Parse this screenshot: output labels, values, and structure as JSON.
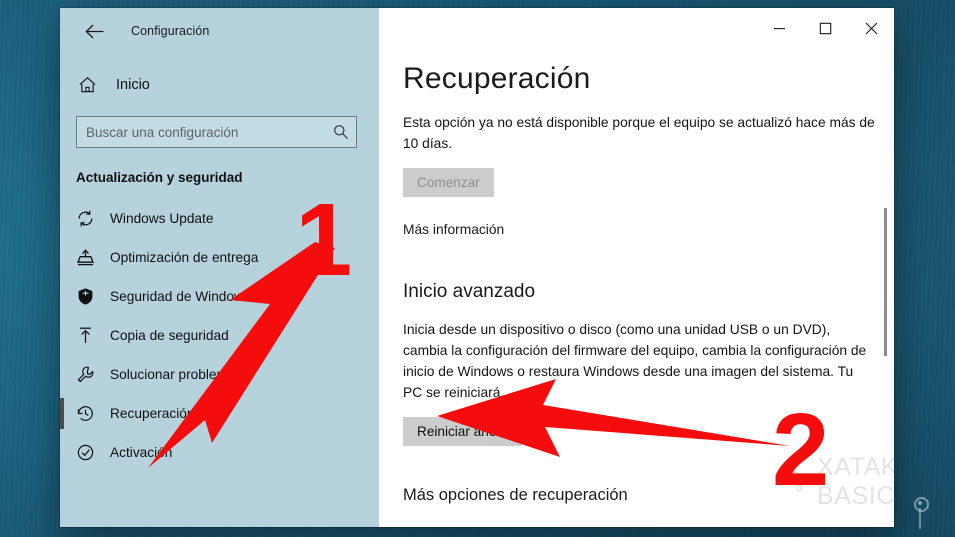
{
  "window": {
    "app_title": "Configuración",
    "back_icon": "back-arrow-icon",
    "controls": {
      "minimize": "–",
      "maximize": "□",
      "close": "✕"
    }
  },
  "sidebar": {
    "home": {
      "label": "Inicio",
      "icon": "home-icon"
    },
    "search": {
      "placeholder": "Buscar una configuración",
      "value": "",
      "icon": "search-icon"
    },
    "group_title": "Actualización y seguridad",
    "items": [
      {
        "label": "Windows Update",
        "icon": "sync-icon",
        "selected": false
      },
      {
        "label": "Optimización de entrega",
        "icon": "delivery-optimization-icon",
        "selected": false
      },
      {
        "label": "Seguridad de Windows",
        "icon": "shield-icon",
        "selected": false
      },
      {
        "label": "Copia de seguridad",
        "icon": "backup-upload-icon",
        "selected": false
      },
      {
        "label": "Solucionar problemas",
        "icon": "wrench-icon",
        "selected": false
      },
      {
        "label": "Recuperación",
        "icon": "history-clock-icon",
        "selected": true
      },
      {
        "label": "Activación",
        "icon": "check-circle-icon",
        "selected": false
      }
    ]
  },
  "main": {
    "page_title": "Recuperación",
    "reset_section": {
      "description": "Esta opción ya no está disponible porque el equipo se actualizó hace más de 10 días.",
      "button": "Comenzar",
      "button_disabled": true,
      "link": "Más información"
    },
    "advanced_startup": {
      "heading": "Inicio avanzado",
      "description": "Inicia desde un dispositivo o disco (como una unidad USB o un DVD), cambia la configuración del firmware del equipo, cambia la configuración de inicio de Windows o restaura Windows desde una imagen del sistema. Tu PC se reiniciará.",
      "button": "Reiniciar ahora"
    },
    "more_options": "Más opciones de recuperación"
  },
  "watermark": {
    "text": "XATAKA BASICS",
    "icon": "graduation-cap-icon"
  },
  "annotations": {
    "color": "#f50d0d",
    "markers": [
      {
        "label": "1",
        "points_to": "sidebar-item-recuperacion"
      },
      {
        "label": "2",
        "points_to": "restart-now-button"
      }
    ]
  },
  "desktop": {
    "icon": "network-node-icon"
  }
}
